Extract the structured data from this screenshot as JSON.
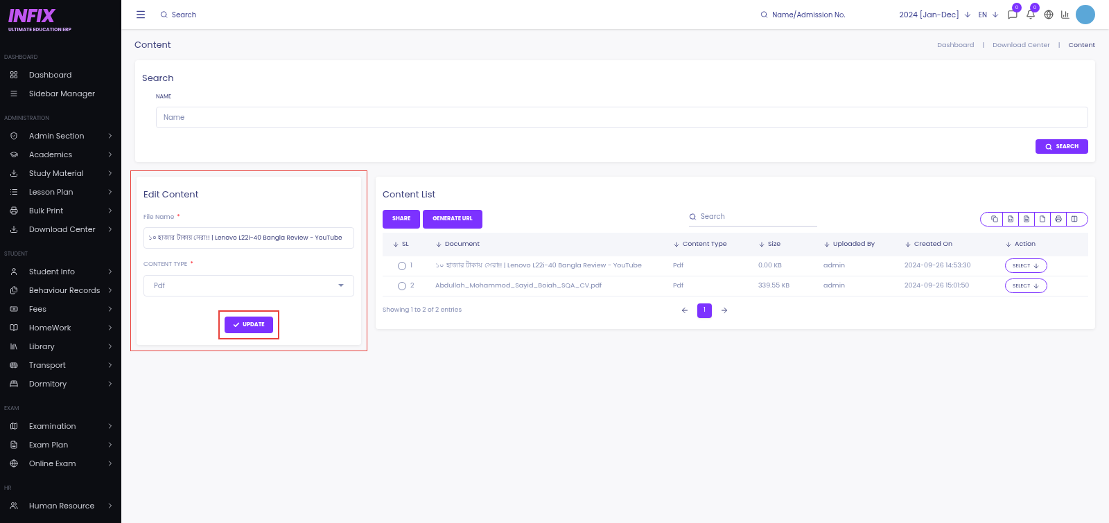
{
  "brand": {
    "logo": "INFIX",
    "tagline": "ULTIMATE EDUCATION ERP"
  },
  "sidebar": [
    {
      "heading": "DASHBOARD",
      "items": [
        {
          "label": "Dashboard",
          "kind": "grid",
          "has_submenu": false
        },
        {
          "label": "Sidebar Manager",
          "kind": "menu",
          "has_submenu": false
        }
      ]
    },
    {
      "heading": "ADMINISTRATION",
      "items": [
        {
          "label": "Admin Section",
          "kind": "admin",
          "has_submenu": true
        },
        {
          "label": "Academics",
          "kind": "cap",
          "has_submenu": true
        },
        {
          "label": "Study Material",
          "kind": "download",
          "has_submenu": true
        },
        {
          "label": "Lesson Plan",
          "kind": "list",
          "has_submenu": true
        },
        {
          "label": "Bulk Print",
          "kind": "print",
          "has_submenu": true
        },
        {
          "label": "Download Center",
          "kind": "download",
          "has_submenu": true
        }
      ]
    },
    {
      "heading": "STUDENT",
      "items": [
        {
          "label": "Student Info",
          "kind": "user",
          "has_submenu": true
        },
        {
          "label": "Behaviour Records",
          "kind": "files",
          "has_submenu": true
        },
        {
          "label": "Fees",
          "kind": "money",
          "has_submenu": true
        },
        {
          "label": "HomeWork",
          "kind": "book",
          "has_submenu": true
        },
        {
          "label": "Library",
          "kind": "library",
          "has_submenu": true
        },
        {
          "label": "Transport",
          "kind": "bus",
          "has_submenu": true
        },
        {
          "label": "Dormitory",
          "kind": "bed",
          "has_submenu": true
        }
      ]
    },
    {
      "heading": "EXAM",
      "items": [
        {
          "label": "Examination",
          "kind": "map",
          "has_submenu": true
        },
        {
          "label": "Exam Plan",
          "kind": "doc",
          "has_submenu": true
        },
        {
          "label": "Online Exam",
          "kind": "globe",
          "has_submenu": true
        }
      ]
    },
    {
      "heading": "HR",
      "items": [
        {
          "label": "Human Resource",
          "kind": "users",
          "has_submenu": true
        }
      ]
    }
  ],
  "header": {
    "search": {
      "placeholder": "Search"
    },
    "student_search": {
      "placeholder": "Name/Admission No."
    },
    "session": "2024 [Jan-Dec]",
    "language": "EN",
    "message_count": "0",
    "notification_count": "0"
  },
  "page_title": "Content",
  "breadcrumb": [
    {
      "label": "Dashboard",
      "current": false
    },
    {
      "label": "Download Center",
      "current": false
    },
    {
      "label": "Content",
      "current": true
    }
  ],
  "breadcrumb_separators": [
    "|",
    "|"
  ],
  "search_panel": {
    "title": "Search",
    "field_label": "NAME",
    "placeholder": "Name",
    "button": "SEARCH"
  },
  "edit_panel": {
    "title": "Edit Content",
    "highlighted": true,
    "file_name_label": "File Name",
    "file_name_required_mark": "*",
    "content_type_required_mark": "*",
    "file_name_value": "১০ হাজার টাকায় সেরা!! | Lenovo L22i-40 Bangla Review - YouTube",
    "content_type_label": "CONTENT TYPE",
    "content_type_value": "Pdf",
    "button": "UPDATE",
    "button_highlighted": true
  },
  "content_list": {
    "title": "Content List",
    "buttons": [
      "SHARE",
      "GENERATE URL"
    ],
    "search_placeholder": "Search",
    "columns": [
      "SL",
      "Document",
      "Content Type",
      "Size",
      "Uploaded By",
      "Created On",
      "Action"
    ],
    "rows": [
      {
        "sl": "1",
        "document": "১০ হাজার টাকায় সেরা!! | Lenovo L22i-40 Bangla Review - YouTube",
        "content_type": "Pdf",
        "size": "0.00 KB",
        "uploaded_by": "admin",
        "created_on": "2024-09-26 14:53:30",
        "action": "SELECT",
        "selected": false
      },
      {
        "sl": "2",
        "document": "Abdullah_Mohammod_Sayid_Boiah_SQA_CV.pdf",
        "content_type": "Pdf",
        "size": "339.55 KB",
        "uploaded_by": "admin",
        "created_on": "2024-09-26 15:01:50",
        "action": "SELECT",
        "selected": false
      }
    ],
    "summary": "Showing 1 to 2 of 2 entries",
    "pages": [
      {
        "label": "1",
        "selected": true
      }
    ]
  }
}
